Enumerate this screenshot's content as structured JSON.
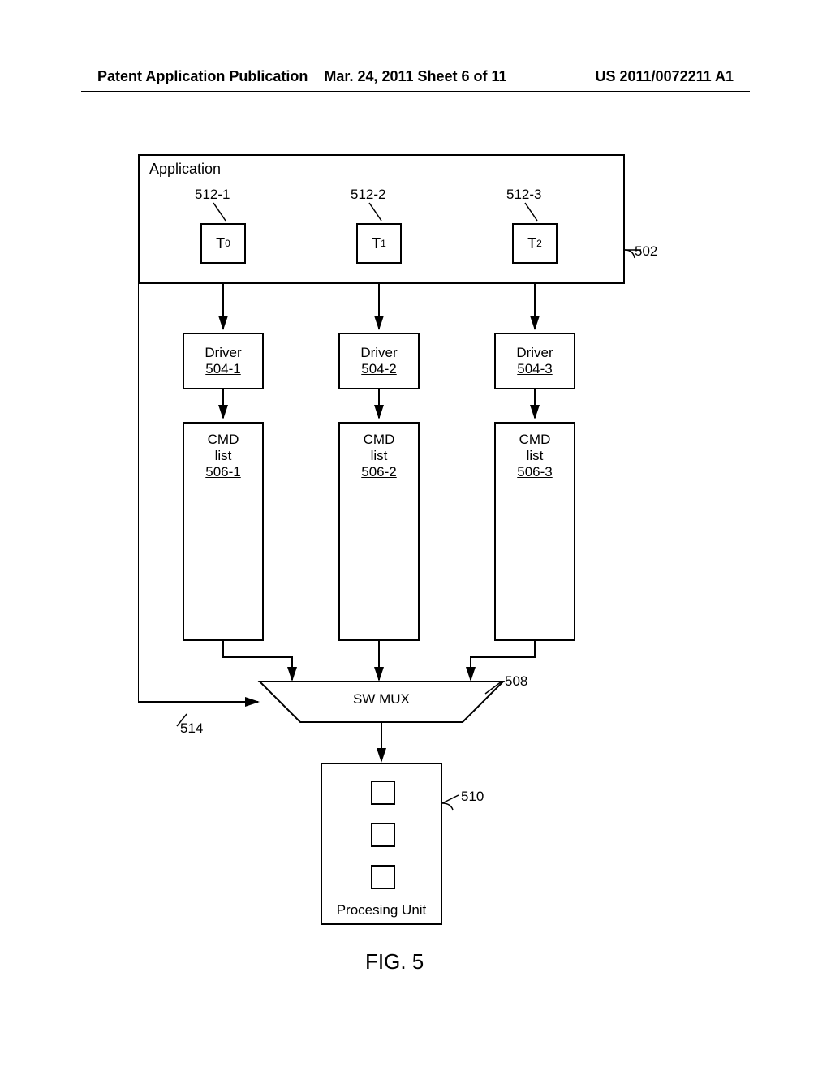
{
  "header": {
    "left": "Patent Application Publication",
    "mid": "Mar. 24, 2011  Sheet 6 of 11",
    "right": "US 2011/0072211 A1"
  },
  "application": {
    "label": "Application",
    "ref": "502",
    "threads": [
      {
        "name": "T",
        "sub": "0",
        "ref": "512-1"
      },
      {
        "name": "T",
        "sub": "1",
        "ref": "512-2"
      },
      {
        "name": "T",
        "sub": "2",
        "ref": "512-3"
      }
    ]
  },
  "drivers": [
    {
      "title": "Driver",
      "ref": "504-1"
    },
    {
      "title": "Driver",
      "ref": "504-2"
    },
    {
      "title": "Driver",
      "ref": "504-3"
    }
  ],
  "cmds": [
    {
      "title1": "CMD",
      "title2": "list",
      "ref": "506-1"
    },
    {
      "title1": "CMD",
      "title2": "list",
      "ref": "506-2"
    },
    {
      "title1": "CMD",
      "title2": "list",
      "ref": "506-3"
    }
  ],
  "swmux": {
    "label": "SW MUX",
    "ref": "508"
  },
  "ctrl_ref": "514",
  "proc": {
    "label": "Procesing Unit",
    "ref": "510"
  },
  "figure_caption": "FIG. 5"
}
